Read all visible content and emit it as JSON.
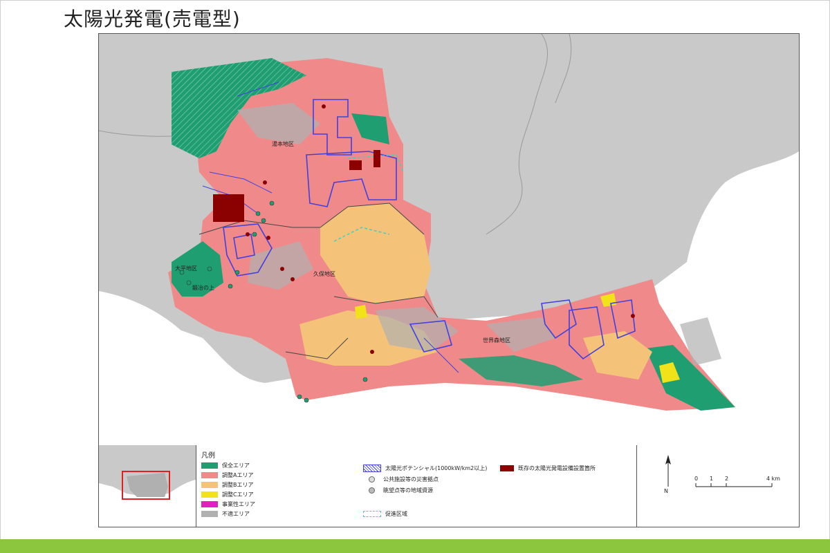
{
  "title": "太陽光発電(売電型)",
  "map": {
    "district_labels": [
      "湯本地区",
      "久保地区",
      "世界森地区",
      "大平地区",
      "鍛冶の上"
    ],
    "colors": {
      "background": "#c9c9c9",
      "sea": "#ffffff",
      "conservation": "#1f9e72",
      "adjust_a": "#f08a8a",
      "adjust_b": "#f5c27a",
      "adjust_c": "#f2e21a",
      "business": "#e020c0",
      "unsuitable": "#b0b0b0",
      "existing_solar": "#8b0000",
      "potential": "#4040e0",
      "promotion": "#40d0c0"
    }
  },
  "legend": {
    "title": "凡例",
    "zones": [
      {
        "label": "保全エリア",
        "color": "#1f9e72"
      },
      {
        "label": "調整Aエリア",
        "color": "#f08a8a"
      },
      {
        "label": "調整Bエリア",
        "color": "#f5c27a"
      },
      {
        "label": "調整Cエリア",
        "color": "#f2e21a"
      },
      {
        "label": "事業性エリア",
        "color": "#e020c0"
      },
      {
        "label": "不適エリア",
        "color": "#b0b0b0"
      }
    ],
    "potential_label": "太陽光ポテンシャル(1000kW/km2以上)",
    "public_label": "公共施設等の災害拠点",
    "scenery_label": "眺望点等の地域資源",
    "promotion_label": "促進区域",
    "existing_label": "既存の太陽光発電設備設置箇所"
  },
  "scale": {
    "ticks": [
      "0",
      "1",
      "2",
      "4 km"
    ],
    "north": "N"
  }
}
